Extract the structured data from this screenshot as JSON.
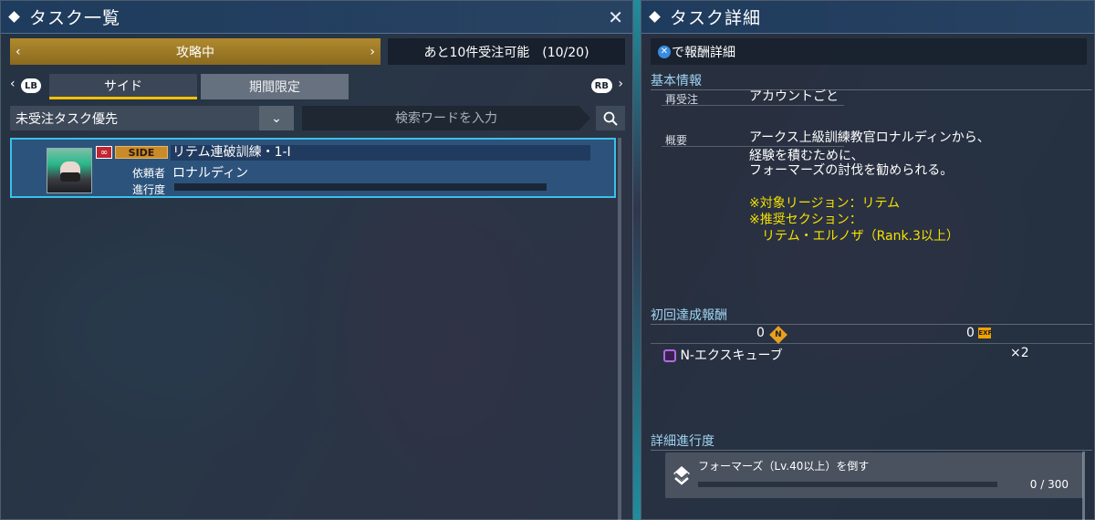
{
  "left_panel": {
    "title": "タスク一覧",
    "status_filter": "攻略中",
    "accept_info": "あと10件受注可能　(10/20)",
    "tabs": [
      {
        "label": "サイド",
        "active": true
      },
      {
        "label": "期間限定",
        "active": false
      }
    ],
    "lb_label": "LB",
    "rb_label": "RB",
    "sort_option": "未受注タスク優先",
    "search_placeholder": "検索ワードを入力",
    "tasks": [
      {
        "loop_icon": "∞",
        "category": "SIDE",
        "title": "リテム連破訓練・1-Ⅰ",
        "client_label": "依頼者",
        "client": "ロナルディン",
        "progress_label": "進行度",
        "progress": 0
      }
    ]
  },
  "right_panel": {
    "title": "タスク詳細",
    "reward_detail_label": "で報酬詳細",
    "x_button": "✕",
    "basic_info": {
      "section": "基本情報",
      "reaccept_label": "再受注",
      "reaccept_value": "アカウントごと",
      "summary_label": "概要",
      "summary_lines": [
        "アークス上級訓練教官ロナルディンから、",
        "経験を積むために、",
        "フォーマーズの討伐を勧められる。"
      ],
      "note_lines": [
        "※対象リージョン：リテム",
        "※推奨セクション：",
        "　リテム・エルノザ（Rank.3以上）"
      ]
    },
    "first_reward": {
      "section": "初回達成報酬",
      "meseta": "0",
      "meseta_icon": "N",
      "exp": "0",
      "exp_icon": "EXP",
      "item_name": "N-エクスキューブ",
      "item_qty": "×2"
    },
    "detail_progress": {
      "section": "詳細進行度",
      "objective": "フォーマーズ（Lv.40以上）を倒す",
      "count": "0 / 300",
      "progress": 0
    }
  },
  "colors": {
    "accent_gold": "#b08a2e",
    "tab_underline": "#f2c200",
    "selected_border": "#3cc0e8",
    "note_yellow": "#f4e200",
    "section_blue": "#9fd4f0"
  }
}
